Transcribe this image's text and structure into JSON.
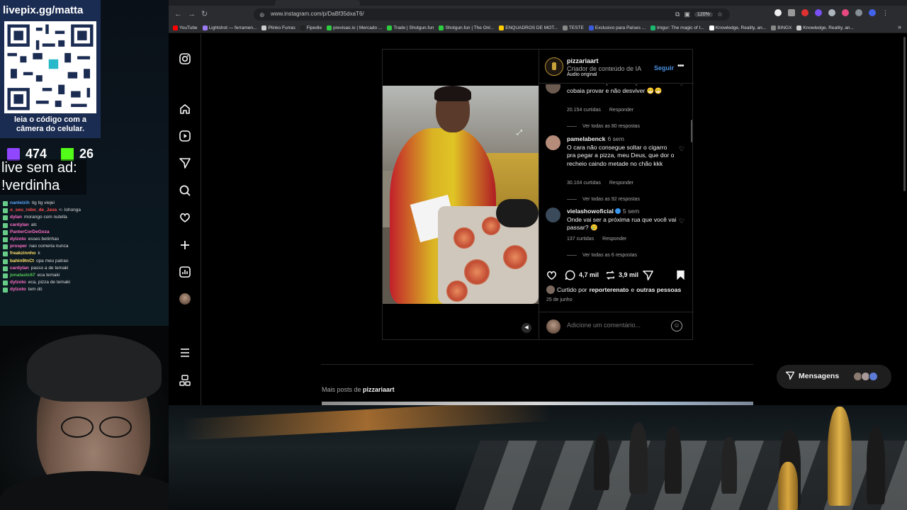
{
  "overlay": {
    "url_label": "livepix.gg/matta",
    "qr_caption": "leia o código com a câmera do celular.",
    "twitch_count": "474",
    "kick_count": "26",
    "promo_line1": "live sem ad:",
    "promo_line2": "!verdinha",
    "chat": [
      {
        "user": "nanlelzih",
        "msg": "tig tig viejei",
        "color": "#57a6ff"
      },
      {
        "user": "o_seu_robo_de_Java",
        "msg": "<- lohonga",
        "color": "#ff4d4d"
      },
      {
        "user": "dylan",
        "msg": "morango com nutella",
        "color": "#ff6ec7"
      },
      {
        "user": "cardylan",
        "msg": "alc",
        "color": "#ff6ec7"
      },
      {
        "user": "PanterCorDeGoza",
        "msg": "",
        "color": "#ff6ec7"
      },
      {
        "user": "dylzoto",
        "msg": "esses betinhas",
        "color": "#ff6ec7"
      },
      {
        "user": "prosper",
        "msg": "nao comeria nunca",
        "color": "#ff6ec7"
      },
      {
        "user": "freakzinnho",
        "msg": "k",
        "color": "#ffe066"
      },
      {
        "user": "bahin9tnCt",
        "msg": "opa meu patrao",
        "color": "#ffe066"
      },
      {
        "user": "cardylan",
        "msg": "passo a de temaki",
        "color": "#ff6ec7"
      },
      {
        "user": "jonatastc67",
        "msg": "eca temaki",
        "color": "#57c957"
      },
      {
        "user": "dylzoto",
        "msg": "eca, pizza de temaki",
        "color": "#ff6ec7"
      },
      {
        "user": "dylzoto",
        "msg": "tem dó",
        "color": "#ff6ec7"
      }
    ]
  },
  "browser": {
    "url": "www.instagram.com/p/DaBf35dxaT6/",
    "zoom": "120%",
    "bookmarks": [
      {
        "label": "YouTube",
        "color": "#ff0000"
      },
      {
        "label": "Lightshot — ferramen...",
        "color": "#9c7cf4"
      },
      {
        "label": "Plinko Furras",
        "color": "#cccccc"
      },
      {
        "label": "Fipedle",
        "color": "#222222"
      },
      {
        "label": "previsao.io | Mercado ...",
        "color": "#2ecc40"
      },
      {
        "label": "Trade | Shotgun.fun",
        "color": "#2ecc40"
      },
      {
        "label": "Shotgun.fun | The Onl...",
        "color": "#2ecc40"
      },
      {
        "label": "ENQUADROS DE MOT...",
        "color": "#ffcc00"
      },
      {
        "label": "TESTE",
        "color": "#888888"
      },
      {
        "label": "Exclusivo para Países ...",
        "color": "#3b5bdb"
      },
      {
        "label": "Imgur: The magic of t...",
        "color": "#1bb76e"
      },
      {
        "label": "Knowledge, Reality, an...",
        "color": "#ffffff"
      },
      {
        "label": "BINGX",
        "color": "#888888"
      },
      {
        "label": "Knowledge, Reality, an...",
        "color": "#cccccc"
      }
    ]
  },
  "post": {
    "username": "pizzariaart",
    "subtitle": "Criador de conteúdo de IA",
    "audio": "Áudio original",
    "follow_label": "Seguir",
    "comments": [
      {
        "user": "",
        "time": "",
        "text": "os meninos esperaram a primeira cobaia provar e não desviver 😁😁",
        "likes": "20.154 curtidas",
        "reply": "Responder",
        "replies": "Ver todas as 80 respostas",
        "verified": false
      },
      {
        "user": "pamelabenck",
        "time": "6 sem",
        "text": "O cara não consegue soltar o cigarro pra pegar a pizza, meu Deus, que dor o recheio caindo metade no chão kkk",
        "likes": "30.104 curtidas",
        "reply": "Responder",
        "replies": "Ver todas as 92 respostas",
        "verified": false
      },
      {
        "user": "vielashowoficial",
        "time": "5 sem",
        "text": "Onde vai ser a próxima rua que você vai passar? 🥲",
        "likes": "137 curtidas",
        "reply": "Responder",
        "replies": "Ver todas as 6 respostas",
        "verified": true
      }
    ],
    "comment_count": "4,7 mil",
    "share_count": "3,9 mil",
    "liked_prefix": "Curtido por",
    "liked_user": "reporterenato",
    "liked_and": "e",
    "liked_others": "outras pessoas",
    "date": "25 de junho",
    "add_comment_placeholder": "Adicione um comentário..."
  },
  "more_posts": {
    "prefix": "Mais posts de",
    "user": "pizzariaart"
  },
  "messages_label": "Mensagens",
  "icons": [
    "instagram-icon",
    "home-icon",
    "reels-icon",
    "explore-icon",
    "search-icon",
    "heart-icon",
    "create-icon",
    "dashboard-icon",
    "menu-icon",
    "threads-icon"
  ]
}
